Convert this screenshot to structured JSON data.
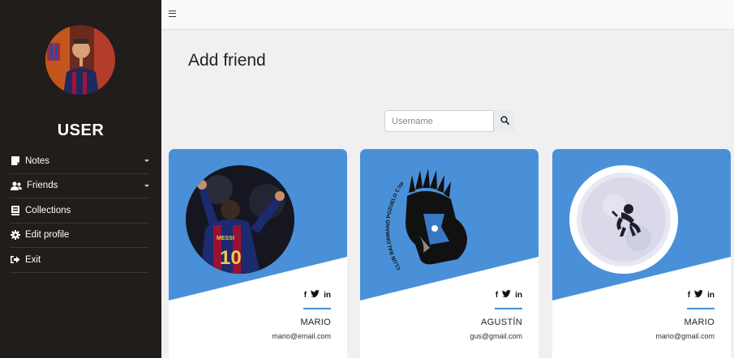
{
  "sidebar": {
    "user_label": "USER",
    "items": [
      {
        "label": "Notes",
        "icon": "note-icon",
        "dropdown": true
      },
      {
        "label": "Friends",
        "icon": "users-icon",
        "dropdown": true
      },
      {
        "label": "Collections",
        "icon": "book-icon",
        "dropdown": false
      },
      {
        "label": "Edit profile",
        "icon": "gear-icon",
        "dropdown": false
      },
      {
        "label": "Exit",
        "icon": "exit-icon",
        "dropdown": false
      }
    ]
  },
  "topbar": {
    "menu_icon": "hamburger-icon"
  },
  "main": {
    "title": "Add friend",
    "search": {
      "placeholder": "Username",
      "value": ""
    }
  },
  "friends": [
    {
      "name": "MARIO",
      "email": "mario@email.com",
      "social": [
        "f",
        "t",
        "in"
      ]
    },
    {
      "name": "AGUSTÍN",
      "email": "gus@gmail.com",
      "social": [
        "f",
        "t",
        "in"
      ]
    },
    {
      "name": "MARIO",
      "email": "mario@gmail.com",
      "social": [
        "f",
        "t",
        "in"
      ]
    }
  ],
  "colors": {
    "sidebar": "#211d1b",
    "card_accent": "#4a90d9",
    "background": "#f0f0f0"
  }
}
